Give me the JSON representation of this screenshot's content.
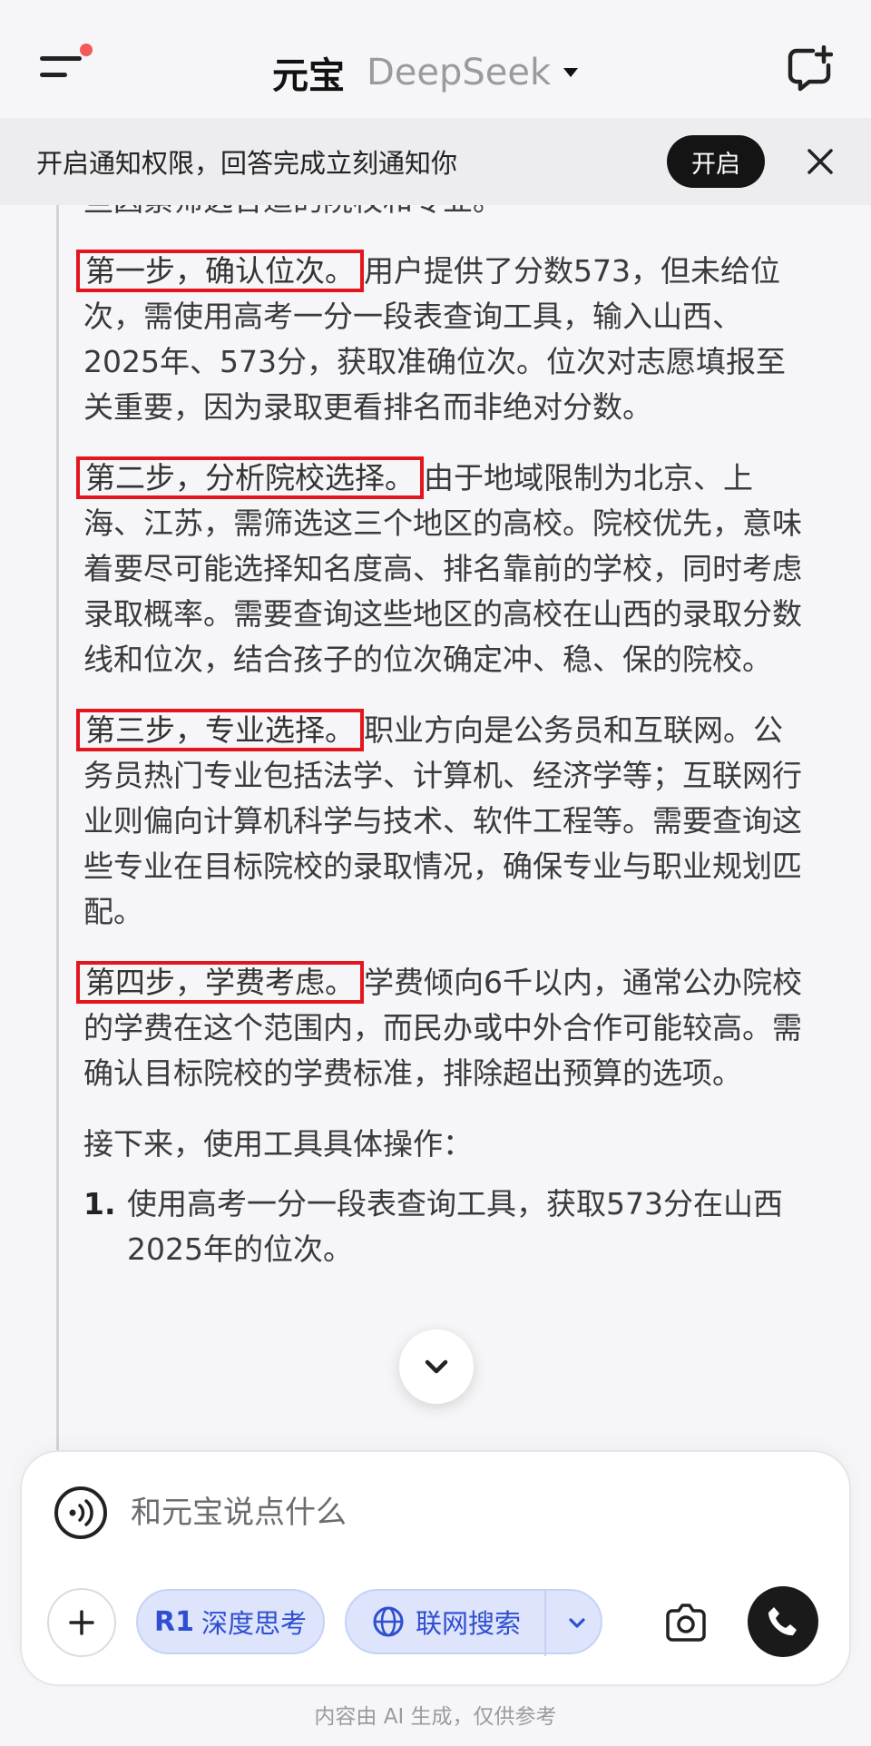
{
  "header": {
    "app_name": "元宝",
    "model_name": "DeepSeek"
  },
  "banner": {
    "text": "开启通知权限，回答完成立刻通知你",
    "enable_label": "开启"
  },
  "article": {
    "intro": "些因素筛选合适的院校和专业。",
    "steps": [
      {
        "label": "第一步，确认位次。",
        "text": "用户提供了分数573，但未给位次，需使用高考一分一段表查询工具，输入山西、2025年、573分，获取准确位次。位次对志愿填报至关重要，因为录取更看排名而非绝对分数。"
      },
      {
        "label": "第二步，分析院校选择。",
        "text": "由于地域限制为北京、上海、江苏，需筛选这三个地区的高校。院校优先，意味着要尽可能选择知名度高、排名靠前的学校，同时考虑录取概率。需要查询这些地区的高校在山西的录取分数线和位次，结合孩子的位次确定冲、稳、保的院校。"
      },
      {
        "label": "第三步，专业选择。",
        "text": "职业方向是公务员和互联网。公务员热门专业包括法学、计算机、经济学等；互联网行业则偏向计算机科学与技术、软件工程等。需要查询这些专业在目标院校的录取情况，确保专业与职业规划匹配。"
      },
      {
        "label": "第四步，学费考虑。",
        "text": "学费倾向6千以内，通常公办院校的学费在这个范围内，而民办或中外合作可能较高。需确认目标院校的学费标准，排除超出预算的选项。"
      }
    ],
    "next_line": "接下来，使用工具具体操作：",
    "list": [
      {
        "num": "1.",
        "text": "使用高考一分一段表查询工具，获取573分在山西2025年的位次。"
      }
    ]
  },
  "composer": {
    "placeholder": "和元宝说点什么",
    "r1_badge": "R1",
    "deep_think_label": "深度思考",
    "web_search_label": "联网搜索"
  },
  "footer": {
    "note": "内容由 AI 生成，仅供参考"
  },
  "colors": {
    "accent_blue": "#2f4fd0",
    "highlight_red": "#e3151e",
    "notification_dot": "#f25a5a"
  }
}
